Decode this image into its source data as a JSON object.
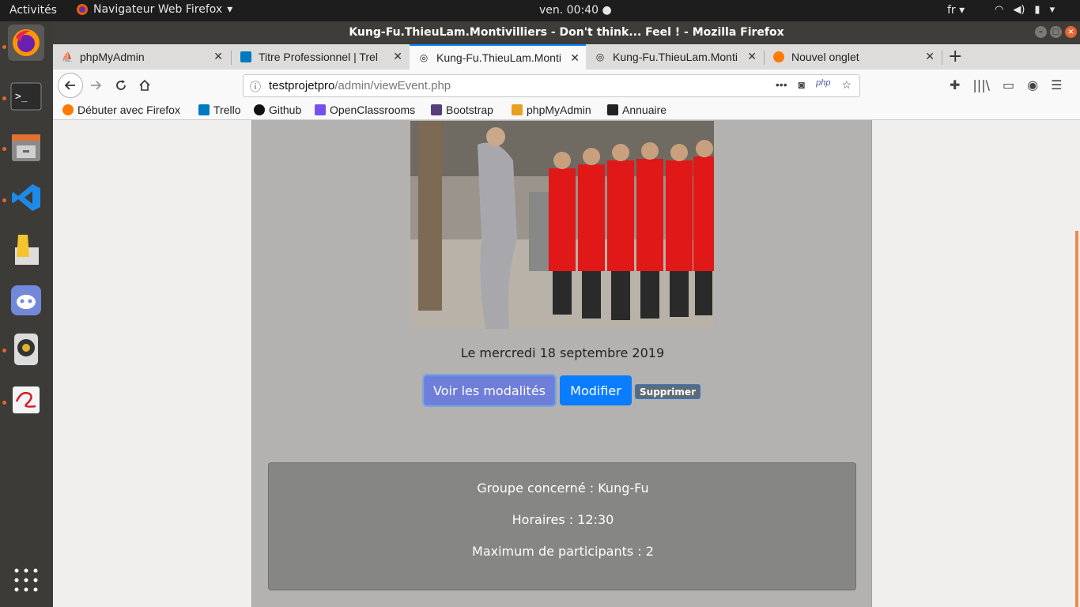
{
  "topbar": {
    "activities": "Activités",
    "app_menu": "Navigateur Web Firefox",
    "clock": "ven. 00:40",
    "lang": "fr"
  },
  "window": {
    "title": "Kung-Fu.ThieuLam.Montivilliers - Don't think... Feel ! - Mozilla Firefox"
  },
  "tabs": [
    {
      "label": "phpMyAdmin"
    },
    {
      "label": "Titre Professionnel | Trel"
    },
    {
      "label": "Kung-Fu.ThieuLam.Monti"
    },
    {
      "label": "Kung-Fu.ThieuLam.Monti"
    },
    {
      "label": "Nouvel onglet"
    }
  ],
  "url": {
    "host": "testprojetpro",
    "path": "/admin/viewEvent.php",
    "php_badge": "php"
  },
  "bookmarks": [
    {
      "label": "Débuter avec Firefox"
    },
    {
      "label": "Trello"
    },
    {
      "label": "Github"
    },
    {
      "label": "OpenClassrooms"
    },
    {
      "label": "Bootstrap"
    },
    {
      "label": "phpMyAdmin"
    },
    {
      "label": "Annuaire"
    }
  ],
  "event": {
    "date": "Le mercredi 18 septembre 2019",
    "btn_modalites": "Voir les modalités",
    "btn_modifier": "Modifier",
    "btn_supprimer": "Supprimer",
    "groupe": "Groupe concerné : Kung-Fu",
    "horaires": "Horaires : 12:30",
    "maximum": "Maximum de participants : 2"
  },
  "colors": {
    "accent": "#0a84ff",
    "modify_button": "#0a7cff",
    "dock_bg": "#3c3b37",
    "ubuntu_orange": "#e8642c"
  }
}
